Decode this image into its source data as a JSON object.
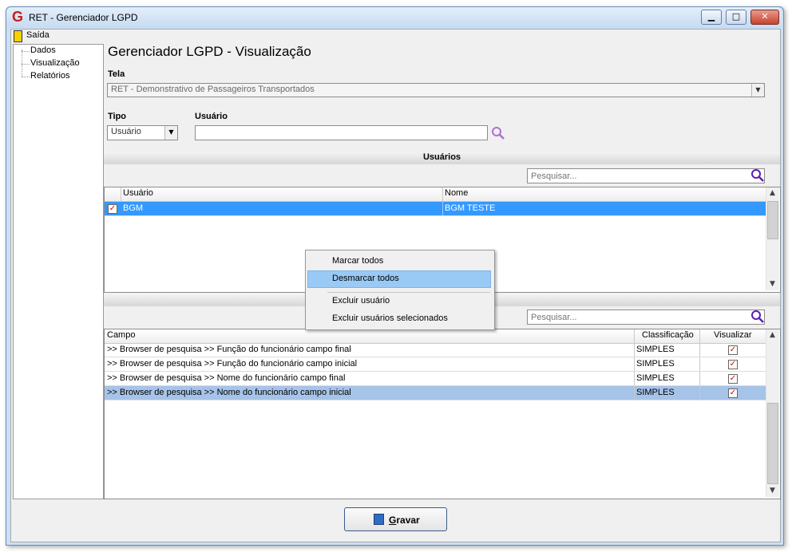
{
  "window": {
    "app_icon": "G",
    "title": "RET - Gerenciador LGPD",
    "controls": {
      "minimize": "▁",
      "maximize": "□",
      "close": "✕"
    }
  },
  "menu": {
    "exit_label": "Saída"
  },
  "tree": {
    "items": [
      "Dados",
      "Visualização",
      "Relatórios"
    ]
  },
  "main": {
    "heading": "Gerenciador LGPD - Visualização",
    "tela_label": "Tela",
    "tela_value": "RET - Demonstrativo de Passageiros Transportados",
    "tipo_label": "Tipo",
    "tipo_value": "Usuário",
    "usuario_label": "Usuário",
    "usuario_value": ""
  },
  "users_section": {
    "title": "Usuários",
    "search_placeholder": "Pesquisar...",
    "columns": [
      "Usuário",
      "Nome"
    ],
    "rows": [
      {
        "checked": true,
        "usuario": "BGM",
        "nome": "BGM TESTE"
      }
    ]
  },
  "fields_section": {
    "search_placeholder": "Pesquisar...",
    "columns": [
      "Campo",
      "Classificação",
      "Visualizar"
    ],
    "rows": [
      {
        "campo": ">> Browser de pesquisa >> Função do funcionário campo final",
        "classificacao": "SIMPLES",
        "visualizar": true
      },
      {
        "campo": ">> Browser de pesquisa >> Função do funcionário campo inicial",
        "classificacao": "SIMPLES",
        "visualizar": true
      },
      {
        "campo": ">> Browser de pesquisa >> Nome do funcionário campo final",
        "classificacao": "SIMPLES",
        "visualizar": true
      },
      {
        "campo": ">> Browser de pesquisa >> Nome do funcionário campo inicial",
        "classificacao": "SIMPLES",
        "visualizar": true
      }
    ]
  },
  "context_menu": {
    "items": [
      "Marcar todos",
      "Desmarcar todos",
      "Excluir usuário",
      "Excluir usuários selecionados"
    ],
    "highlighted": "Desmarcar todos"
  },
  "footer": {
    "save_label": "Gravar",
    "save_hotkey": "G"
  },
  "colors": {
    "selection_blue": "#3399ff",
    "selection_pale": "#a6c3e8",
    "menu_highlight": "#99c9f5",
    "check_red": "#d40000"
  },
  "icons": [
    "app-logo-icon",
    "exit-door-icon",
    "search-icon",
    "dropdown-arrow-icon",
    "checkbox-icon",
    "save-disk-icon"
  ]
}
